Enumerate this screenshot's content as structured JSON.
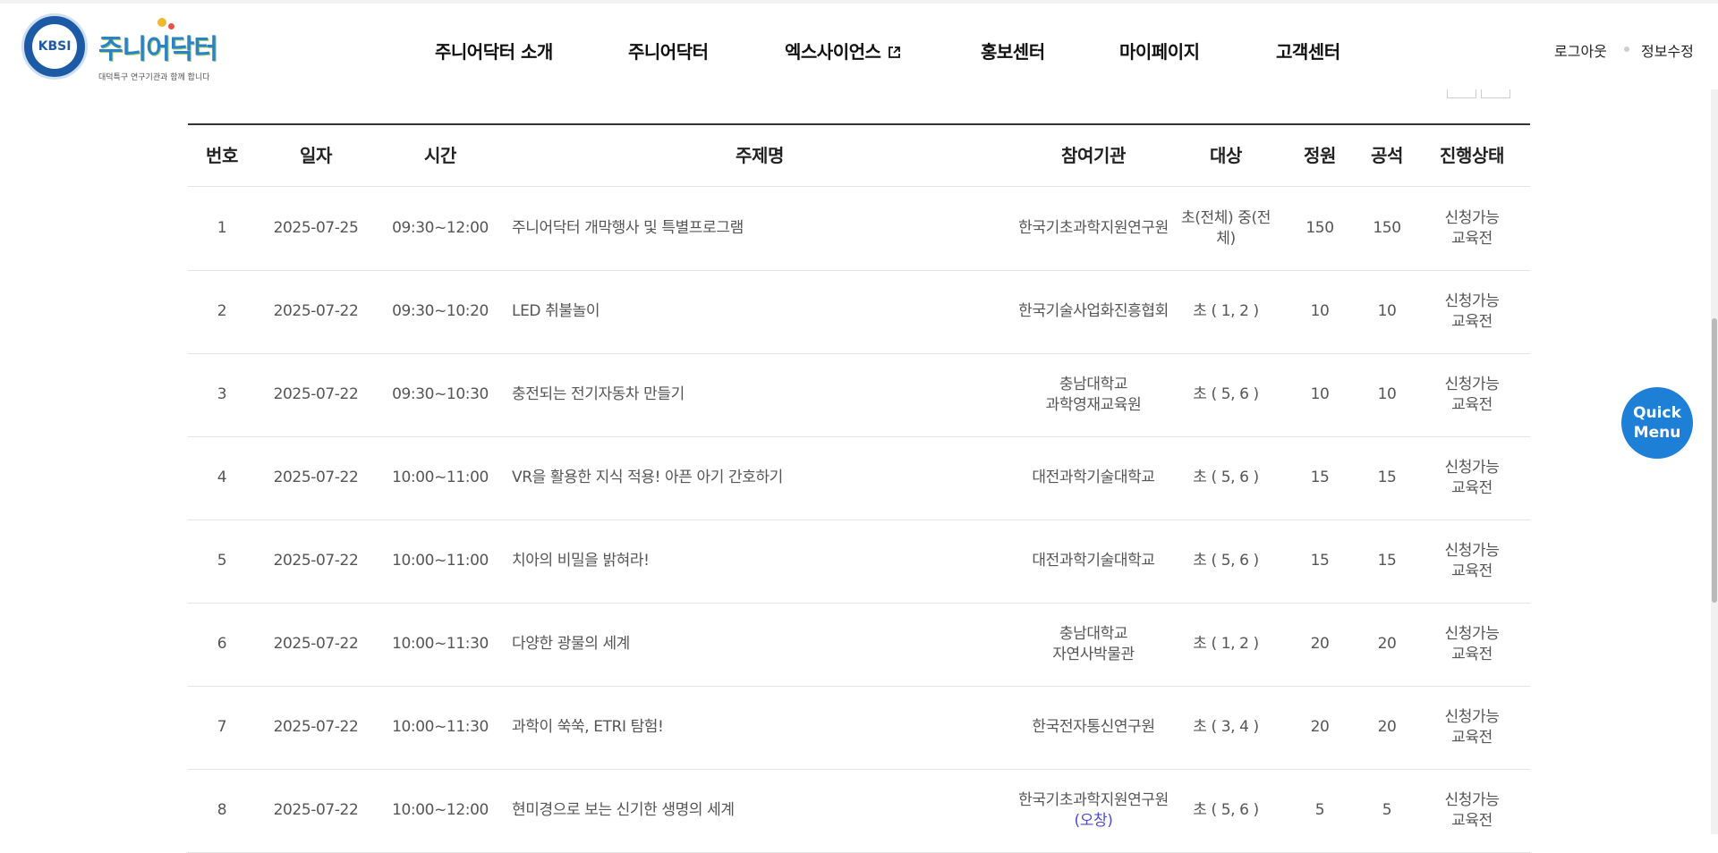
{
  "header": {
    "logo_seal_text": "KBSI",
    "brand": "주니어닥터",
    "tagline": "대덕특구 연구기관과 함께 합니다",
    "nav": [
      {
        "label": "주니어닥터 소개"
      },
      {
        "label": "주니어닥터"
      },
      {
        "label": "엑스사이언스",
        "icon": "external-link-icon"
      },
      {
        "label": "홍보센터"
      },
      {
        "label": "마이페이지"
      },
      {
        "label": "고객센터"
      }
    ],
    "util": {
      "logout": "로그아웃",
      "edit_info": "정보수정"
    }
  },
  "table": {
    "columns": [
      "번호",
      "일자",
      "시간",
      "주제명",
      "참여기관",
      "대상",
      "정원",
      "공석",
      "진행상태"
    ],
    "rows": [
      {
        "no": "1",
        "date": "2025-07-25",
        "time": "09:30~12:00",
        "title": "주니어닥터 개막행사 및 특별프로그램",
        "org": [
          "한국기초과학지원연구원"
        ],
        "target": "초(전체) 중(전체)",
        "capacity": "150",
        "vacancy": "150",
        "status": [
          "신청가능",
          "교육전"
        ]
      },
      {
        "no": "2",
        "date": "2025-07-22",
        "time": "09:30~10:20",
        "title": "LED 취불놀이",
        "org": [
          "한국기술사업화진흥협회"
        ],
        "target": "초 ( 1, 2 )",
        "capacity": "10",
        "vacancy": "10",
        "status": [
          "신청가능",
          "교육전"
        ]
      },
      {
        "no": "3",
        "date": "2025-07-22",
        "time": "09:30~10:30",
        "title": "충전되는 전기자동차 만들기",
        "org": [
          "충남대학교",
          "과학영재교육원"
        ],
        "target": "초 ( 5, 6 )",
        "capacity": "10",
        "vacancy": "10",
        "status": [
          "신청가능",
          "교육전"
        ]
      },
      {
        "no": "4",
        "date": "2025-07-22",
        "time": "10:00~11:00",
        "title": "VR을 활용한 지식 적용! 아픈 아기 간호하기",
        "org": [
          "대전과학기술대학교"
        ],
        "target": "초 ( 5, 6 )",
        "capacity": "15",
        "vacancy": "15",
        "status": [
          "신청가능",
          "교육전"
        ]
      },
      {
        "no": "5",
        "date": "2025-07-22",
        "time": "10:00~11:00",
        "title": "치아의 비밀을 밝혀라!",
        "org": [
          "대전과학기술대학교"
        ],
        "target": "초 ( 5, 6 )",
        "capacity": "15",
        "vacancy": "15",
        "status": [
          "신청가능",
          "교육전"
        ]
      },
      {
        "no": "6",
        "date": "2025-07-22",
        "time": "10:00~11:30",
        "title": "다양한 광물의 세계",
        "org": [
          "충남대학교",
          "자연사박물관"
        ],
        "target": "초 ( 1, 2 )",
        "capacity": "20",
        "vacancy": "20",
        "status": [
          "신청가능",
          "교육전"
        ]
      },
      {
        "no": "7",
        "date": "2025-07-22",
        "time": "10:00~11:30",
        "title": "과학이 쑥쑥, ETRI 탐험!",
        "org": [
          "한국전자통신연구원"
        ],
        "target": "초 ( 3, 4 )",
        "capacity": "20",
        "vacancy": "20",
        "status": [
          "신청가능",
          "교육전"
        ]
      },
      {
        "no": "8",
        "date": "2025-07-22",
        "time": "10:00~12:00",
        "title": "현미경으로 보는 신기한 생명의 세계",
        "org": [
          "한국기초과학지원연구원"
        ],
        "org_note": "(오창)",
        "target": "초 ( 5, 6 )",
        "capacity": "5",
        "vacancy": "5",
        "status": [
          "신청가능",
          "교육전"
        ]
      }
    ]
  },
  "quick_menu": {
    "line1": "Quick",
    "line2": "Menu"
  },
  "colors": {
    "accent": "#1e7fd6",
    "org_note": "#4b4bd8",
    "brand": "#2b83c6"
  }
}
